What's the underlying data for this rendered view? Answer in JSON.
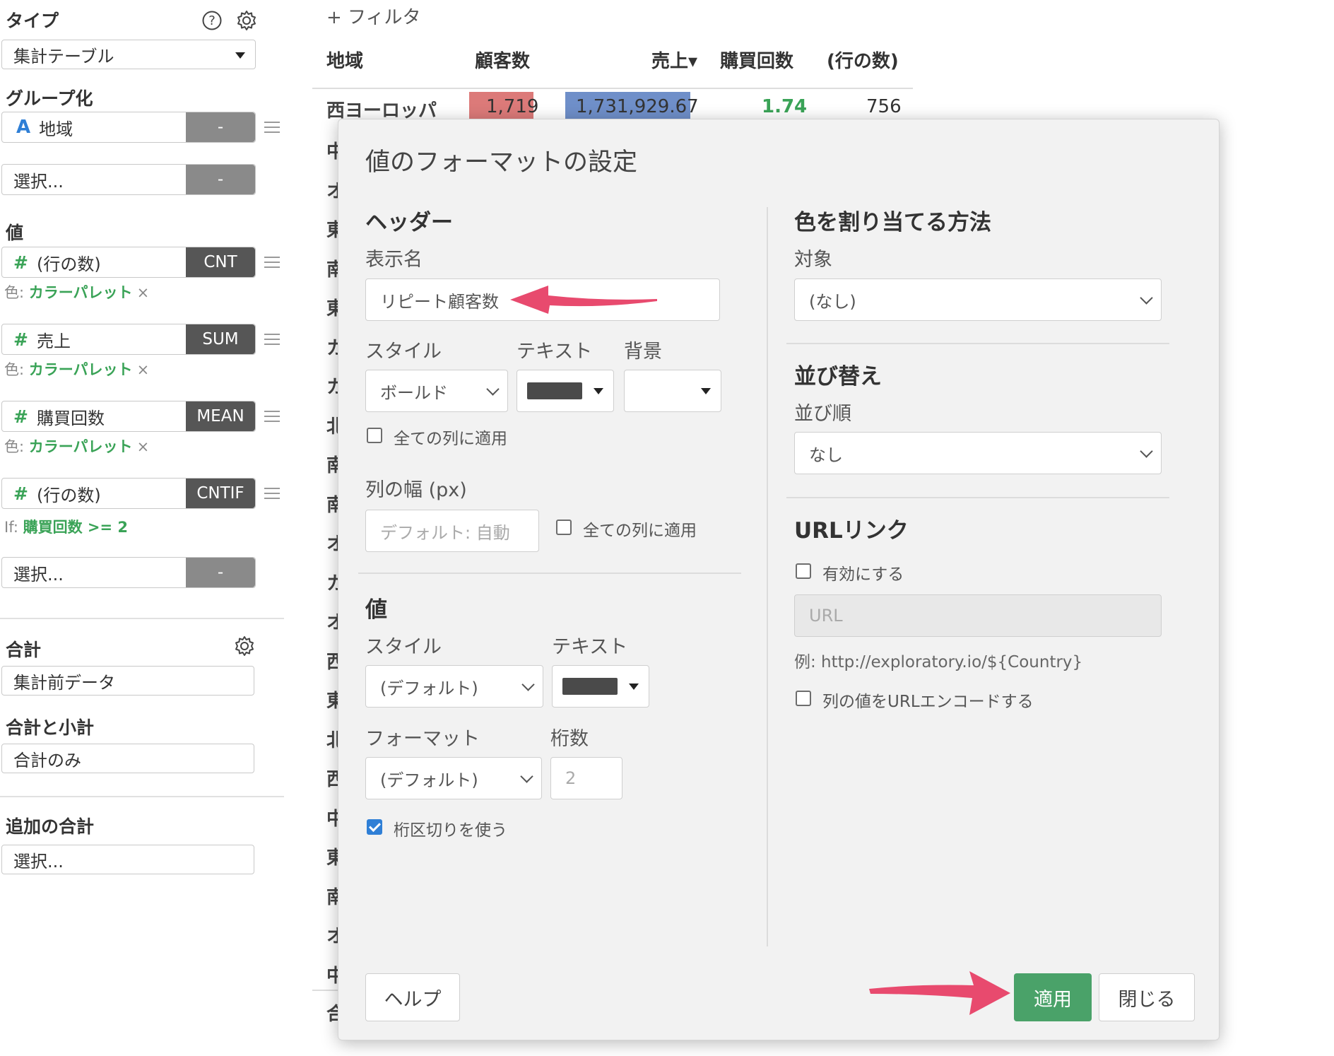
{
  "sidebar": {
    "type_label": "タイプ",
    "type_value": "集計テーブル",
    "group_label": "グループ化",
    "group_item": {
      "icon": "A",
      "label": "地域",
      "tag": "-"
    },
    "group_select": {
      "label": "選択...",
      "tag": "-"
    },
    "values_label": "値",
    "values": [
      {
        "label": "(行の数)",
        "agg": "CNT",
        "sub_prefix": "色:",
        "sub_value": "カラーパレット",
        "sub_x": "×"
      },
      {
        "label": "売上",
        "agg": "SUM",
        "sub_prefix": "色:",
        "sub_value": "カラーパレット",
        "sub_x": "×"
      },
      {
        "label": "購買回数",
        "agg": "MEAN",
        "sub_prefix": "色:",
        "sub_value": "カラーパレット",
        "sub_x": "×"
      },
      {
        "label": "(行の数)",
        "agg": "CNTIF",
        "sub_prefix": "If:",
        "sub_value": "購買回数 >= 2",
        "sub_x": ""
      }
    ],
    "values_select": {
      "label": "選択...",
      "tag": "-"
    },
    "total_label": "合計",
    "total_value": "集計前データ",
    "subtotal_label": "合計と小計",
    "subtotal_value": "合計のみ",
    "extra_total_label": "追加の合計",
    "extra_total_value": "選択..."
  },
  "table": {
    "filter_label": "+ フィルタ",
    "headers": [
      "地域",
      "顧客数",
      "売上▾",
      "購買回数",
      "(行の数)"
    ],
    "first_row": [
      "西ヨーロッパ",
      "1,719",
      "1,731,929.67",
      "1.74",
      "756"
    ],
    "row_fragments": [
      "中",
      "オ",
      "東",
      "南",
      "東",
      "カ",
      "カ",
      "北",
      "南",
      "南",
      "オ",
      "カ",
      "オ",
      "西",
      "東",
      "北",
      "西",
      "中",
      "東",
      "南",
      "オ",
      "中"
    ],
    "total_fragment": "合"
  },
  "modal": {
    "title": "値のフォーマットの設定",
    "header_section": "ヘッダー",
    "display_name_label": "表示名",
    "display_name_value": "リピート顧客数",
    "style_label": "スタイル",
    "text_label": "テキスト",
    "bg_label": "背景",
    "style_value": "ボールド",
    "apply_all_cols": "全ての列に適用",
    "col_width_label": "列の幅 (px)",
    "col_width_placeholder": "デフォルト: 自動",
    "col_width_apply_all": "全ての列に適用",
    "value_section": "値",
    "value_style_label": "スタイル",
    "value_text_label": "テキスト",
    "value_style_value": "(デフォルト)",
    "format_label": "フォーマット",
    "digits_label": "桁数",
    "format_value": "(デフォルト)",
    "digits_value": "2",
    "thousand_sep": "桁区切りを使う",
    "color_section": "色を割り当てる方法",
    "target_label": "対象",
    "target_value": "(なし)",
    "sort_section": "並び替え",
    "sort_order_label": "並び順",
    "sort_order_value": "なし",
    "url_section": "URLリンク",
    "url_enable": "有効にする",
    "url_placeholder": "URL",
    "url_example": "例: http://exploratory.io/${Country}",
    "url_encode": "列の値をURLエンコードする",
    "help_button": "ヘルプ",
    "apply_button": "適用",
    "close_button": "閉じる"
  },
  "colors": {
    "green": "#3aa357",
    "apply": "#4aa269",
    "arrow": "#e84a6e",
    "bar_red": "#dc7a79",
    "bar_blue": "#6f8fc9"
  }
}
